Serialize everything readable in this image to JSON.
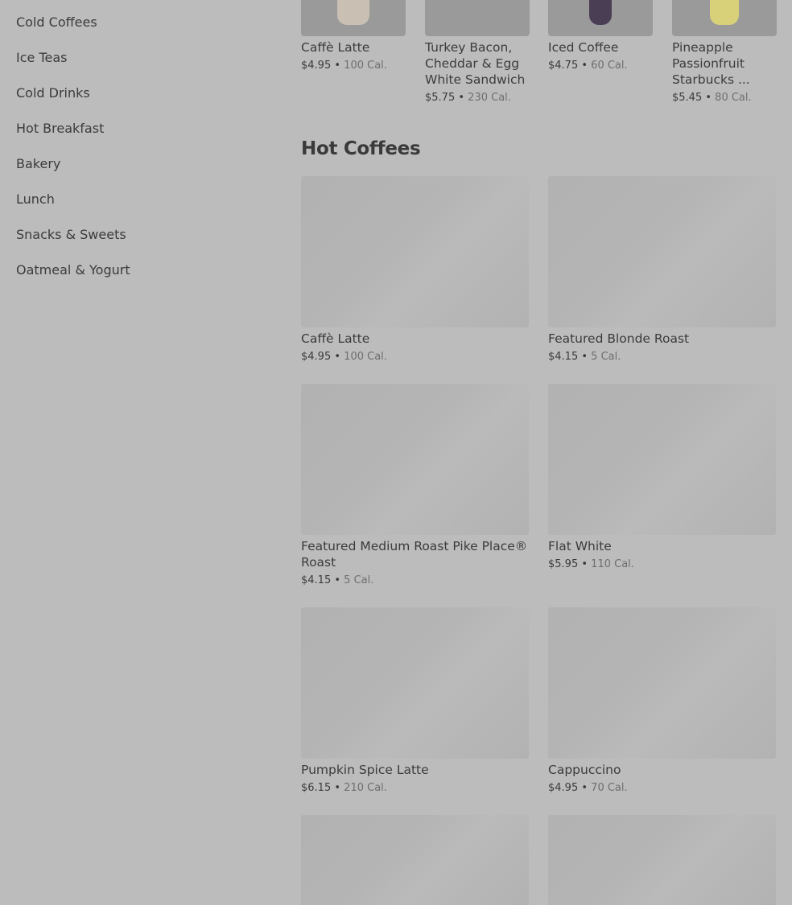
{
  "sidebar": {
    "items": [
      {
        "label": "Cold Coffees"
      },
      {
        "label": "Ice Teas"
      },
      {
        "label": "Cold Drinks"
      },
      {
        "label": "Hot Breakfast"
      },
      {
        "label": "Bakery"
      },
      {
        "label": "Lunch"
      },
      {
        "label": "Snacks & Sweets"
      },
      {
        "label": "Oatmeal & Yogurt"
      }
    ]
  },
  "featured": [
    {
      "name": "Caffè Latte",
      "price": "$4.95",
      "sep": "•",
      "cal": "100 Cal."
    },
    {
      "name": "Turkey Bacon, Cheddar & Egg White Sandwich",
      "price": "$5.75",
      "sep": "•",
      "cal": "230 Cal."
    },
    {
      "name": "Iced Coffee",
      "price": "$4.75",
      "sep": "•",
      "cal": "60 Cal."
    },
    {
      "name": "Pineapple Passionfruit Starbucks ...",
      "price": "$5.45",
      "sep": "•",
      "cal": "80 Cal."
    }
  ],
  "section": {
    "title": "Hot Coffees"
  },
  "products": [
    {
      "name": "Caffè Latte",
      "price": "$4.95",
      "sep": "•",
      "cal": "100 Cal."
    },
    {
      "name": "Featured Blonde Roast",
      "price": "$4.15",
      "sep": "•",
      "cal": "5 Cal."
    },
    {
      "name": "Featured Medium Roast Pike Place® Roast",
      "price": "$4.15",
      "sep": "•",
      "cal": "5 Cal."
    },
    {
      "name": "Flat White",
      "price": "$5.95",
      "sep": "•",
      "cal": "110 Cal."
    },
    {
      "name": "Pumpkin Spice Latte",
      "price": "$6.15",
      "sep": "•",
      "cal": "210 Cal."
    },
    {
      "name": "Cappuccino",
      "price": "$4.95",
      "sep": "•",
      "cal": "70 Cal."
    }
  ]
}
